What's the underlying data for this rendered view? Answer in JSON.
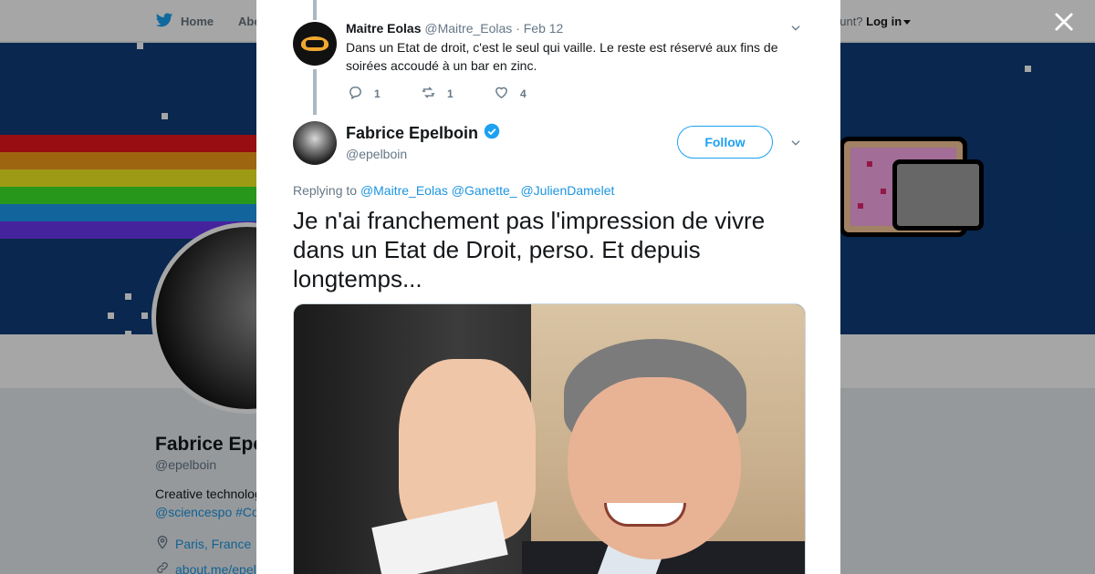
{
  "background": {
    "nav": {
      "home_label": "Home",
      "about_label": "Abo"
    },
    "login": {
      "prefix": "ccount?",
      "login_label": "Log in"
    },
    "profile": {
      "name": "Fabrice Epe",
      "handle": "@epelboin",
      "bio_line1": "Creative technolog",
      "bio_line2": "@sciencespo #Co",
      "location": "Paris, France",
      "link": "about.me/epel"
    }
  },
  "modal": {
    "reply": {
      "name": "Maitre Eolas",
      "handle": "@Maitre_Eolas",
      "date": "· Feb 12",
      "text": "Dans un Etat de droit, c'est le seul qui vaille. Le reste est réservé aux fins de soirées accoudé à un bar en zinc.",
      "actions": {
        "replies": "1",
        "retweets": "1",
        "likes": "4"
      }
    },
    "tweet": {
      "name": "Fabrice Epelboin",
      "handle": "@epelboin",
      "follow_label": "Follow",
      "replying_prefix": "Replying to",
      "mentions": [
        "@Maitre_Eolas",
        "@Ganette_",
        "@JulienDamelet"
      ],
      "text": "Je n'ai franchement pas l'impression de vivre dans un Etat de Droit, perso. Et depuis longtemps..."
    }
  },
  "icons": {
    "bird": "twitter-bird-icon",
    "close": "close-icon",
    "verified": "verified-badge-icon",
    "chevron": "chevron-down-icon",
    "reply": "reply-icon",
    "retweet": "retweet-icon",
    "like": "heart-icon",
    "location": "location-pin-icon",
    "link": "link-icon"
  },
  "colors": {
    "brand_blue": "#1da1f2",
    "link_blue": "#1b95e0",
    "banner": "#0e3d7a",
    "muted": "#657786"
  }
}
